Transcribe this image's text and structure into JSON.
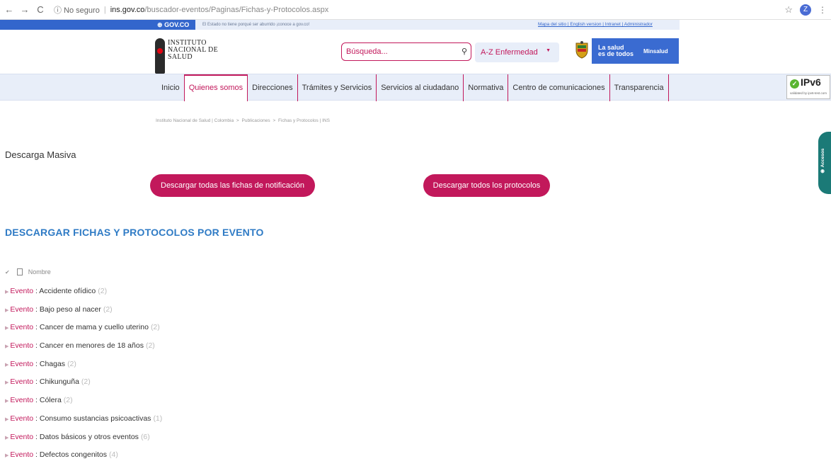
{
  "browser": {
    "info_text": "No seguro",
    "host": "ins.gov.co",
    "path": "/buscador-eventos/Paginas/Fichas-y-Protocolos.aspx",
    "profile_initial": "Z"
  },
  "govbar": {
    "brand": "GOV.CO",
    "tagline": "El Estado no tiene porqué ser aburrido ¡conoce a gov.co!",
    "links": "Mapa del sitio | English version | Intranet | Administrador"
  },
  "header": {
    "logo_line1": "INSTITUTO",
    "logo_line2": "NACIONAL DE",
    "logo_line3": "SALUD",
    "search_placeholder": "Búsqueda...",
    "az_label": "A-Z Enfermedad",
    "minsalud_line1": "La salud",
    "minsalud_line2": "es de todos",
    "minsalud_brand": "Minsalud"
  },
  "nav": {
    "items": [
      "Inicio",
      "Quienes somos",
      "Direcciones",
      "Trámites y Servicios",
      "Servicios al ciudadano",
      "Normativa",
      "Centro de comunicaciones",
      "Transparencia"
    ],
    "ipv6_label": "IPv6",
    "ipv6_sub": "validated by ipv6-test.com"
  },
  "breadcrumb": {
    "home": "Instituto Nacional de Salud | Colombia",
    "sep": ">",
    "pubs": "Publicaciones",
    "current": "Fichas y Protocolos | INS"
  },
  "main": {
    "descarga_title": "Descarga Masiva",
    "btn_fichas": "Descargar todas las fichas de notificación",
    "btn_protocolos": "Descargar todos los protocolos",
    "section_title": "DESCARGAR FICHAS Y PROTOCOLOS POR EVENTO",
    "list_header": "Nombre",
    "event_label": "Evento",
    "rows": [
      {
        "name": "Accidente ofídico",
        "count": "(2)"
      },
      {
        "name": "Bajo peso al nacer",
        "count": "(2)"
      },
      {
        "name": "Cancer de mama y cuello uterino",
        "count": "(2)"
      },
      {
        "name": "Cancer en menores de 18 años",
        "count": "(2)"
      },
      {
        "name": "Chagas",
        "count": "(2)"
      },
      {
        "name": "Chikunguña",
        "count": "(2)"
      },
      {
        "name": "Cólera",
        "count": "(2)"
      },
      {
        "name": "Consumo sustancias psicoactivas",
        "count": "(1)"
      },
      {
        "name": "Datos básicos y otros eventos",
        "count": "(6)"
      },
      {
        "name": "Defectos congenitos",
        "count": "(4)"
      }
    ]
  },
  "side_tab": {
    "label": "Accesos"
  }
}
